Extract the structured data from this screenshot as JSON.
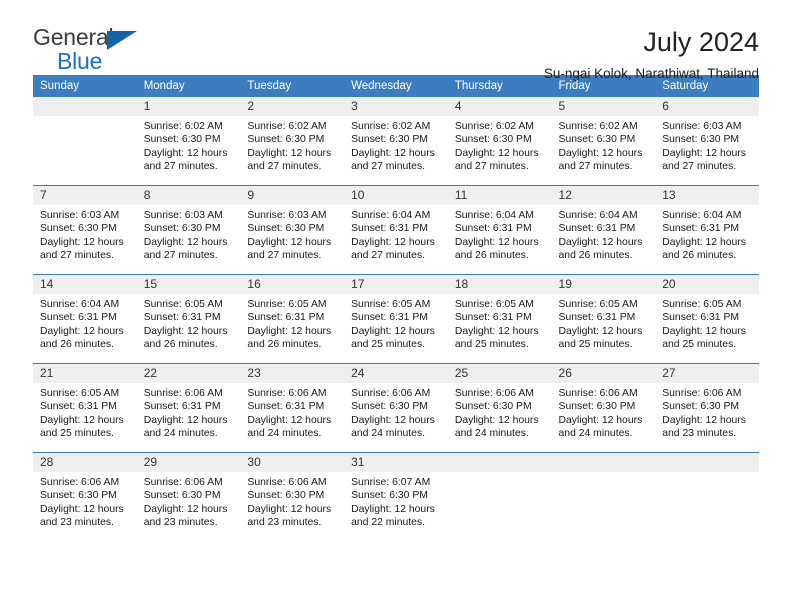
{
  "logo": {
    "word_top": "General",
    "word_bottom": "Blue",
    "triangle": "blue-triangle-icon",
    "color_text": "#3c3c3c",
    "color_blue": "#1b72c0"
  },
  "header": {
    "title": "July 2024",
    "subtitle": "Su-ngai Kolok, Narathiwat, Thailand"
  },
  "theme": {
    "header_blue": "#3b7dbf",
    "daynum_gray": "#efefef",
    "text": "#1a1a1a"
  },
  "weekdays": [
    "Sunday",
    "Monday",
    "Tuesday",
    "Wednesday",
    "Thursday",
    "Friday",
    "Saturday"
  ],
  "weeks": [
    [
      {
        "day": "",
        "blank": true,
        "sunrise": "",
        "sunset": "",
        "daylight_1": "",
        "daylight_2": ""
      },
      {
        "day": "1",
        "sunrise": "Sunrise: 6:02 AM",
        "sunset": "Sunset: 6:30 PM",
        "daylight_1": "Daylight: 12 hours",
        "daylight_2": "and 27 minutes."
      },
      {
        "day": "2",
        "sunrise": "Sunrise: 6:02 AM",
        "sunset": "Sunset: 6:30 PM",
        "daylight_1": "Daylight: 12 hours",
        "daylight_2": "and 27 minutes."
      },
      {
        "day": "3",
        "sunrise": "Sunrise: 6:02 AM",
        "sunset": "Sunset: 6:30 PM",
        "daylight_1": "Daylight: 12 hours",
        "daylight_2": "and 27 minutes."
      },
      {
        "day": "4",
        "sunrise": "Sunrise: 6:02 AM",
        "sunset": "Sunset: 6:30 PM",
        "daylight_1": "Daylight: 12 hours",
        "daylight_2": "and 27 minutes."
      },
      {
        "day": "5",
        "sunrise": "Sunrise: 6:02 AM",
        "sunset": "Sunset: 6:30 PM",
        "daylight_1": "Daylight: 12 hours",
        "daylight_2": "and 27 minutes."
      },
      {
        "day": "6",
        "sunrise": "Sunrise: 6:03 AM",
        "sunset": "Sunset: 6:30 PM",
        "daylight_1": "Daylight: 12 hours",
        "daylight_2": "and 27 minutes."
      }
    ],
    [
      {
        "day": "7",
        "sunrise": "Sunrise: 6:03 AM",
        "sunset": "Sunset: 6:30 PM",
        "daylight_1": "Daylight: 12 hours",
        "daylight_2": "and 27 minutes."
      },
      {
        "day": "8",
        "sunrise": "Sunrise: 6:03 AM",
        "sunset": "Sunset: 6:30 PM",
        "daylight_1": "Daylight: 12 hours",
        "daylight_2": "and 27 minutes."
      },
      {
        "day": "9",
        "sunrise": "Sunrise: 6:03 AM",
        "sunset": "Sunset: 6:30 PM",
        "daylight_1": "Daylight: 12 hours",
        "daylight_2": "and 27 minutes."
      },
      {
        "day": "10",
        "sunrise": "Sunrise: 6:04 AM",
        "sunset": "Sunset: 6:31 PM",
        "daylight_1": "Daylight: 12 hours",
        "daylight_2": "and 27 minutes."
      },
      {
        "day": "11",
        "sunrise": "Sunrise: 6:04 AM",
        "sunset": "Sunset: 6:31 PM",
        "daylight_1": "Daylight: 12 hours",
        "daylight_2": "and 26 minutes."
      },
      {
        "day": "12",
        "sunrise": "Sunrise: 6:04 AM",
        "sunset": "Sunset: 6:31 PM",
        "daylight_1": "Daylight: 12 hours",
        "daylight_2": "and 26 minutes."
      },
      {
        "day": "13",
        "sunrise": "Sunrise: 6:04 AM",
        "sunset": "Sunset: 6:31 PM",
        "daylight_1": "Daylight: 12 hours",
        "daylight_2": "and 26 minutes."
      }
    ],
    [
      {
        "day": "14",
        "sunrise": "Sunrise: 6:04 AM",
        "sunset": "Sunset: 6:31 PM",
        "daylight_1": "Daylight: 12 hours",
        "daylight_2": "and 26 minutes."
      },
      {
        "day": "15",
        "sunrise": "Sunrise: 6:05 AM",
        "sunset": "Sunset: 6:31 PM",
        "daylight_1": "Daylight: 12 hours",
        "daylight_2": "and 26 minutes."
      },
      {
        "day": "16",
        "sunrise": "Sunrise: 6:05 AM",
        "sunset": "Sunset: 6:31 PM",
        "daylight_1": "Daylight: 12 hours",
        "daylight_2": "and 26 minutes."
      },
      {
        "day": "17",
        "sunrise": "Sunrise: 6:05 AM",
        "sunset": "Sunset: 6:31 PM",
        "daylight_1": "Daylight: 12 hours",
        "daylight_2": "and 25 minutes."
      },
      {
        "day": "18",
        "sunrise": "Sunrise: 6:05 AM",
        "sunset": "Sunset: 6:31 PM",
        "daylight_1": "Daylight: 12 hours",
        "daylight_2": "and 25 minutes."
      },
      {
        "day": "19",
        "sunrise": "Sunrise: 6:05 AM",
        "sunset": "Sunset: 6:31 PM",
        "daylight_1": "Daylight: 12 hours",
        "daylight_2": "and 25 minutes."
      },
      {
        "day": "20",
        "sunrise": "Sunrise: 6:05 AM",
        "sunset": "Sunset: 6:31 PM",
        "daylight_1": "Daylight: 12 hours",
        "daylight_2": "and 25 minutes."
      }
    ],
    [
      {
        "day": "21",
        "sunrise": "Sunrise: 6:05 AM",
        "sunset": "Sunset: 6:31 PM",
        "daylight_1": "Daylight: 12 hours",
        "daylight_2": "and 25 minutes."
      },
      {
        "day": "22",
        "sunrise": "Sunrise: 6:06 AM",
        "sunset": "Sunset: 6:31 PM",
        "daylight_1": "Daylight: 12 hours",
        "daylight_2": "and 24 minutes."
      },
      {
        "day": "23",
        "sunrise": "Sunrise: 6:06 AM",
        "sunset": "Sunset: 6:31 PM",
        "daylight_1": "Daylight: 12 hours",
        "daylight_2": "and 24 minutes."
      },
      {
        "day": "24",
        "sunrise": "Sunrise: 6:06 AM",
        "sunset": "Sunset: 6:30 PM",
        "daylight_1": "Daylight: 12 hours",
        "daylight_2": "and 24 minutes."
      },
      {
        "day": "25",
        "sunrise": "Sunrise: 6:06 AM",
        "sunset": "Sunset: 6:30 PM",
        "daylight_1": "Daylight: 12 hours",
        "daylight_2": "and 24 minutes."
      },
      {
        "day": "26",
        "sunrise": "Sunrise: 6:06 AM",
        "sunset": "Sunset: 6:30 PM",
        "daylight_1": "Daylight: 12 hours",
        "daylight_2": "and 24 minutes."
      },
      {
        "day": "27",
        "sunrise": "Sunrise: 6:06 AM",
        "sunset": "Sunset: 6:30 PM",
        "daylight_1": "Daylight: 12 hours",
        "daylight_2": "and 23 minutes."
      }
    ],
    [
      {
        "day": "28",
        "sunrise": "Sunrise: 6:06 AM",
        "sunset": "Sunset: 6:30 PM",
        "daylight_1": "Daylight: 12 hours",
        "daylight_2": "and 23 minutes."
      },
      {
        "day": "29",
        "sunrise": "Sunrise: 6:06 AM",
        "sunset": "Sunset: 6:30 PM",
        "daylight_1": "Daylight: 12 hours",
        "daylight_2": "and 23 minutes."
      },
      {
        "day": "30",
        "sunrise": "Sunrise: 6:06 AM",
        "sunset": "Sunset: 6:30 PM",
        "daylight_1": "Daylight: 12 hours",
        "daylight_2": "and 23 minutes."
      },
      {
        "day": "31",
        "sunrise": "Sunrise: 6:07 AM",
        "sunset": "Sunset: 6:30 PM",
        "daylight_1": "Daylight: 12 hours",
        "daylight_2": "and 22 minutes."
      },
      {
        "day": "",
        "blank": true,
        "sunrise": "",
        "sunset": "",
        "daylight_1": "",
        "daylight_2": ""
      },
      {
        "day": "",
        "blank": true,
        "sunrise": "",
        "sunset": "",
        "daylight_1": "",
        "daylight_2": ""
      },
      {
        "day": "",
        "blank": true,
        "sunrise": "",
        "sunset": "",
        "daylight_1": "",
        "daylight_2": ""
      }
    ]
  ]
}
